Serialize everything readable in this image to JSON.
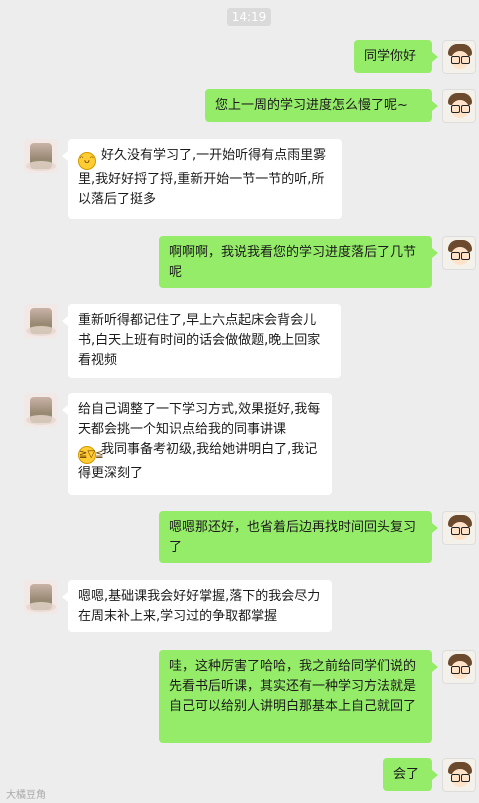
{
  "timestamp": "14:19",
  "messages": [
    {
      "side": "me",
      "text": "同学你好"
    },
    {
      "side": "me",
      "text": "您上一周的学习进度怎么慢了呢~"
    },
    {
      "side": "other",
      "text": "好久没有学习了,一开始听得有点雨里雾里,我好好捋了捋,重新开始一节一节的听,所以落后了挺多",
      "emoji": "grin-emoji"
    },
    {
      "side": "me",
      "text": "啊啊啊，我说我看您的学习进度落后了几节呢"
    },
    {
      "side": "other",
      "text": "重新听得都记住了,早上六点起床会背会儿书,白天上班有时间的话会做做题,晚上回家看视频"
    },
    {
      "side": "other",
      "text_a": "给自己调整了一下学习方式,效果挺好,我每天都会挑一个知识点给我的同事讲课",
      "text_b": "我同事备考初级,我给她讲明白了,我记得更深刻了",
      "emoji": "laugh-emoji"
    },
    {
      "side": "me",
      "text": "嗯嗯那还好，也省着后边再找时间回头复习了"
    },
    {
      "side": "other",
      "text": "嗯嗯,基础课我会好好掌握,落下的我会尽力在周末补上来,学习过的争取都掌握"
    },
    {
      "side": "me",
      "text": "哇，这种厉害了哈哈，我之前给同学们说的先看书后听课，其实还有一种学习方法就是自己可以给别人讲明白那基本上自己就回了"
    },
    {
      "side": "me",
      "text": "会了"
    }
  ],
  "watermark": "大橘豆角"
}
